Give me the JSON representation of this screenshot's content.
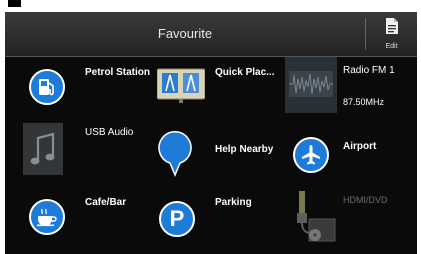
{
  "header": {
    "title": "Favourite",
    "edit_label": "Edit"
  },
  "items": [
    {
      "label": "Petrol Station"
    },
    {
      "label": "Quick Plac..."
    },
    {
      "label": "Radio FM 1",
      "sub": "87.50MHz"
    },
    {
      "label": "USB Audio"
    },
    {
      "label": "Help Nearby"
    },
    {
      "label": "Airport"
    },
    {
      "label": "Cafe/Bar"
    },
    {
      "label": "Parking"
    },
    {
      "label": "HDMI/DVD"
    }
  ],
  "pager": {
    "pages": 2,
    "current": 1
  },
  "colors": {
    "accent": "#1f7bd8",
    "background": "#0a0a0a",
    "disabled_text": "#6d6d6d"
  }
}
